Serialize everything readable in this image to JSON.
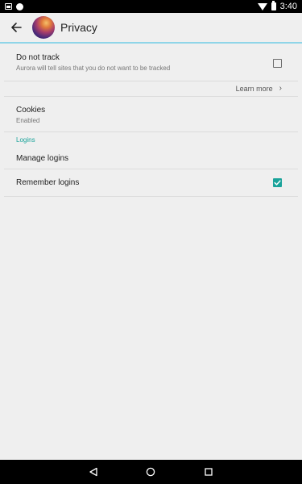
{
  "status_bar": {
    "time": "3:40",
    "left_icons": [
      "image-notification-icon",
      "app-notification-icon"
    ],
    "right_icons": [
      "wifi-icon",
      "battery-icon"
    ]
  },
  "toolbar": {
    "title": "Privacy",
    "back_icon": "arrow-left-icon",
    "logo_icon": "aurora-logo-icon",
    "accent_color": "#8fd5e8"
  },
  "preferences": {
    "do_not_track": {
      "title": "Do not track",
      "summary": "Aurora will tell sites that you do not want to be tracked",
      "checked": false
    },
    "learn_more": {
      "label": "Learn more",
      "icon": "chevron-right-icon"
    },
    "cookies": {
      "title": "Cookies",
      "summary": "Enabled"
    },
    "logins_header": "Logins",
    "manage_logins": {
      "title": "Manage logins"
    },
    "remember_logins": {
      "title": "Remember logins",
      "checked": true
    }
  },
  "colors": {
    "accent": "#1aa39a",
    "background": "#efefef",
    "divider": "#dcdcdc"
  },
  "nav_bar": {
    "buttons": [
      "back-triangle-icon",
      "home-circle-icon",
      "recents-square-icon"
    ]
  }
}
